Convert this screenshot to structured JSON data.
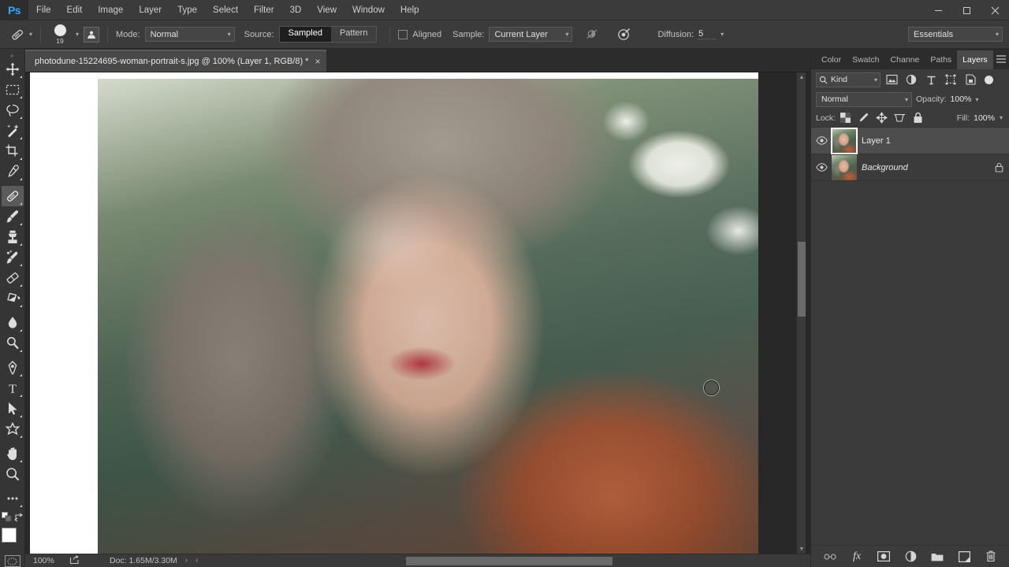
{
  "app": {
    "name": "Ps",
    "workspace": "Essentials"
  },
  "menubar": {
    "items": [
      "File",
      "Edit",
      "Image",
      "Layer",
      "Type",
      "Select",
      "Filter",
      "3D",
      "View",
      "Window",
      "Help"
    ]
  },
  "window_controls": {
    "minimize": "–",
    "maximize": "❐",
    "close": "✕"
  },
  "options_bar": {
    "tool_icon": "healing-brush-icon",
    "brush_size": "19",
    "brush_panel_icon": "brush-panel-icon",
    "mode_label": "Mode:",
    "mode_value": "Normal",
    "source_label": "Source:",
    "source_sampled": "Sampled",
    "source_pattern": "Pattern",
    "aligned_label": "Aligned",
    "sample_label": "Sample:",
    "sample_value": "Current Layer",
    "ignore_adjustment_icon": "ignore-adjustment-layers-icon",
    "pressure_icon": "tablet-pressure-icon",
    "diffusion_label": "Diffusion:",
    "diffusion_value": "5"
  },
  "toolbar": {
    "tools": [
      {
        "name": "move-tool",
        "icon": "move-icon",
        "has_more": true,
        "selected": false
      },
      {
        "name": "rectangular-marquee-tool",
        "icon": "marquee-icon",
        "has_more": true,
        "selected": false
      },
      {
        "name": "lasso-tool",
        "icon": "lasso-icon",
        "has_more": true,
        "selected": false
      },
      {
        "name": "magic-wand-tool",
        "icon": "magic-wand-icon",
        "has_more": true,
        "selected": false
      },
      {
        "name": "crop-tool",
        "icon": "crop-icon",
        "has_more": true,
        "selected": false
      },
      {
        "name": "eyedropper-tool",
        "icon": "eyedropper-icon",
        "has_more": true,
        "selected": false
      },
      {
        "name": "healing-brush-tool",
        "icon": "healing-brush-icon",
        "has_more": true,
        "selected": true
      },
      {
        "name": "brush-tool",
        "icon": "brush-icon",
        "has_more": true,
        "selected": false
      },
      {
        "name": "clone-stamp-tool",
        "icon": "clone-stamp-icon",
        "has_more": true,
        "selected": false
      },
      {
        "name": "history-brush-tool",
        "icon": "history-brush-icon",
        "has_more": true,
        "selected": false
      },
      {
        "name": "eraser-tool",
        "icon": "eraser-icon",
        "has_more": true,
        "selected": false
      },
      {
        "name": "gradient-tool",
        "icon": "paint-bucket-icon",
        "has_more": true,
        "selected": false
      },
      {
        "name": "blur-tool",
        "icon": "blur-drop-icon",
        "has_more": true,
        "selected": false
      },
      {
        "name": "dodge-tool",
        "icon": "dodge-icon",
        "has_more": true,
        "selected": false
      },
      {
        "name": "pen-tool",
        "icon": "pen-icon",
        "has_more": true,
        "selected": false
      },
      {
        "name": "type-tool",
        "icon": "type-icon",
        "has_more": true,
        "selected": false
      },
      {
        "name": "path-selection-tool",
        "icon": "path-arrow-icon",
        "has_more": true,
        "selected": false
      },
      {
        "name": "custom-shape-tool",
        "icon": "shape-star-icon",
        "has_more": true,
        "selected": false
      },
      {
        "name": "hand-tool",
        "icon": "hand-icon",
        "has_more": true,
        "selected": false
      },
      {
        "name": "zoom-tool",
        "icon": "magnifier-icon",
        "has_more": false,
        "selected": false
      },
      {
        "name": "edit-toolbar",
        "icon": "ellipsis-icon",
        "has_more": true,
        "selected": false
      }
    ],
    "foreground_color": "#ffffff",
    "background_color": "#909090",
    "quick_mask_icon": "quick-mask-icon",
    "swap_colors_icon": "swap-colors-icon",
    "default_colors_icon": "default-colors-icon"
  },
  "document": {
    "tab_title": "photodune-15224695-woman-portrait-s.jpg @ 100% (Layer 1, RGB/8) *",
    "close_label": "×",
    "canvas_image": "woman-portrait-photo"
  },
  "status_bar": {
    "zoom": "100%",
    "share_icon": "share-icon",
    "doc_info": "Doc: 1.65M/3.30M",
    "next_arrow": "›",
    "prev_arrow": "‹"
  },
  "panels": {
    "tabs": [
      {
        "label": "Color",
        "active": false
      },
      {
        "label": "Swatch",
        "active": false
      },
      {
        "label": "Channe",
        "active": false
      },
      {
        "label": "Paths",
        "active": false
      },
      {
        "label": "Layers",
        "active": true
      }
    ],
    "menu_icon": "panel-menu-icon",
    "layers": {
      "filter": {
        "search_icon": "search-icon",
        "kind_value": "Kind",
        "chevron": "∨",
        "filter_icons": [
          "pixel-layers-icon",
          "adjustment-layers-icon",
          "type-layers-icon",
          "shape-layers-icon",
          "smart-object-icon"
        ],
        "toggle_name": "filter-toggle"
      },
      "blend_mode": "Normal",
      "opacity_label": "Opacity:",
      "opacity_value": "100%",
      "lock_label": "Lock:",
      "lock_icons": [
        "lock-transparent-pixels-icon",
        "lock-image-pixels-icon",
        "lock-position-icon",
        "lock-artboard-nesting-icon",
        "lock-all-icon"
      ],
      "fill_label": "Fill:",
      "fill_value": "100%",
      "rows": [
        {
          "name": "Layer 1",
          "visible": true,
          "selected": true,
          "locked": false,
          "italic": false
        },
        {
          "name": "Background",
          "visible": true,
          "selected": false,
          "locked": true,
          "italic": true
        }
      ],
      "footer_buttons": [
        {
          "name": "link-layers-button",
          "icon": "link-icon"
        },
        {
          "name": "layer-style-button",
          "icon": "fx-icon"
        },
        {
          "name": "layer-mask-button",
          "icon": "mask-icon"
        },
        {
          "name": "adjustment-layer-button",
          "icon": "adjustment-half-circle-icon"
        },
        {
          "name": "new-group-button",
          "icon": "folder-icon"
        },
        {
          "name": "new-layer-button",
          "icon": "new-layer-icon"
        },
        {
          "name": "delete-layer-button",
          "icon": "trash-icon"
        }
      ]
    }
  },
  "colors": {
    "accent_blue": "#31a8ff",
    "chrome_bg": "#3b3b3b",
    "panel_bg": "#353535",
    "canvas_bg": "#282828",
    "selected_row": "#4d4d4d"
  }
}
